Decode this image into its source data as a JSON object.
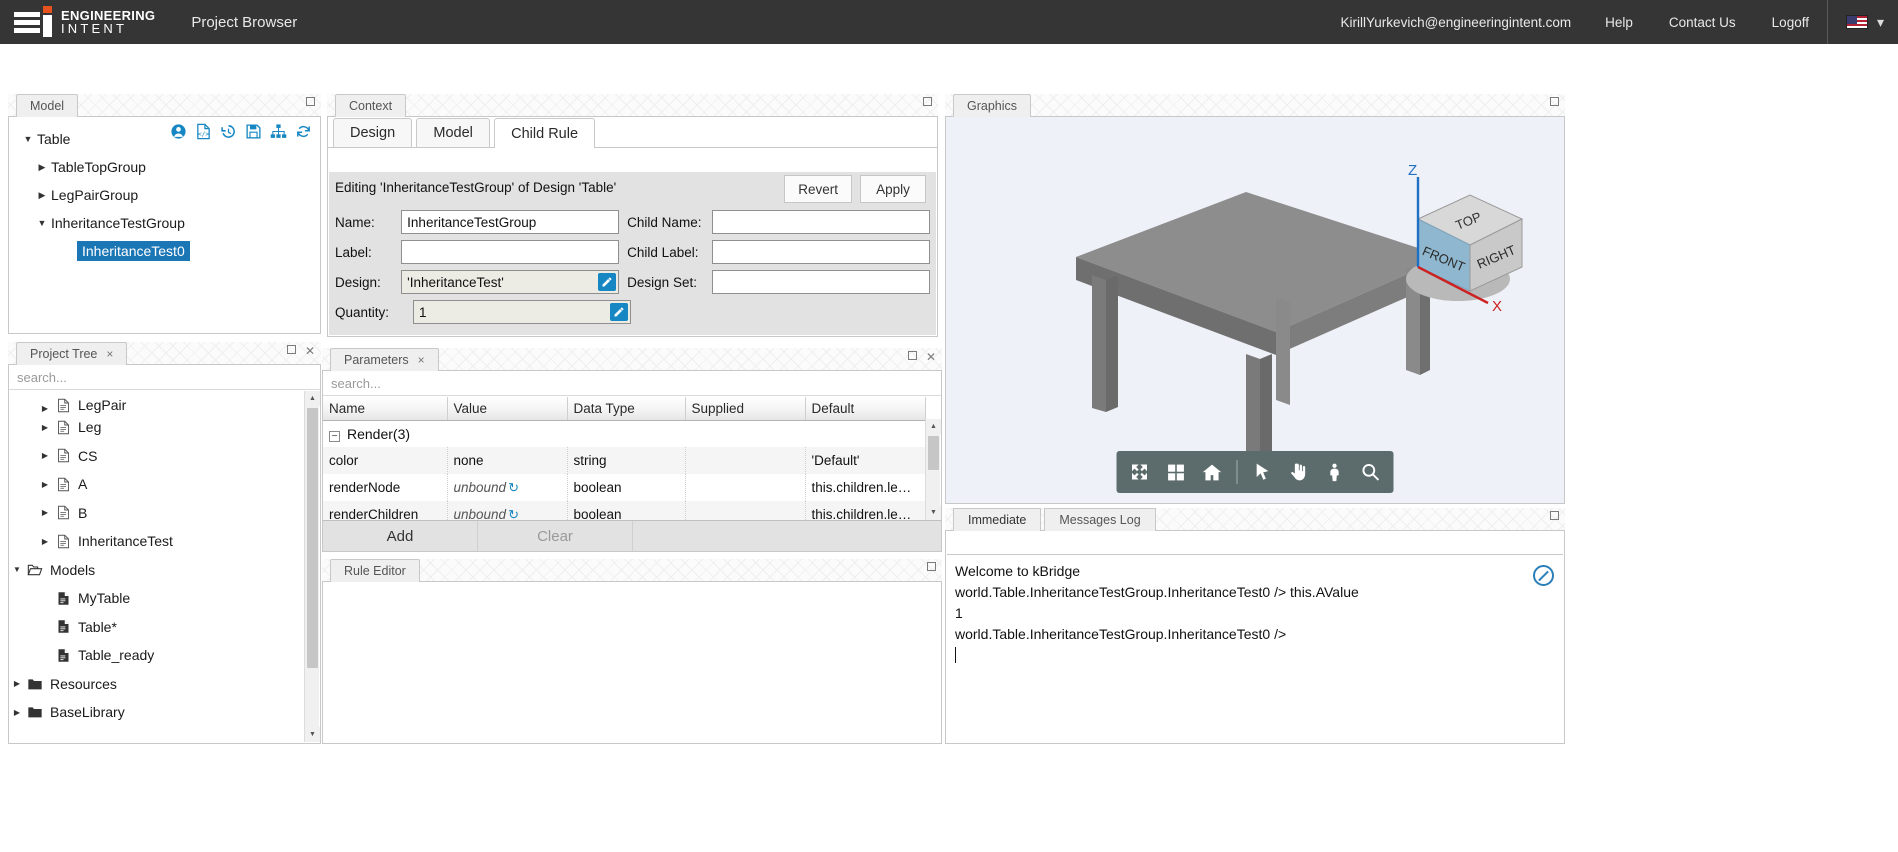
{
  "topbar": {
    "logo_line1": "ENGINEERING",
    "logo_line2": "INTENT",
    "app_title": "Project Browser",
    "email": "KirillYurkevich@engineeringintent.com",
    "help": "Help",
    "contact": "Contact Us",
    "logoff": "Logoff"
  },
  "model_panel": {
    "tab": "Model",
    "toolbar_icons": [
      "user-icon",
      "code-file-icon",
      "history-icon",
      "save-icon",
      "hierarchy-icon",
      "refresh-icon"
    ],
    "tree": [
      {
        "label": "Table",
        "state": "open",
        "depth": 0,
        "selected": false
      },
      {
        "label": "TableTopGroup",
        "state": "closed",
        "depth": 1,
        "selected": false
      },
      {
        "label": "LegPairGroup",
        "state": "closed",
        "depth": 1,
        "selected": false
      },
      {
        "label": "InheritanceTestGroup",
        "state": "open",
        "depth": 1,
        "selected": false
      },
      {
        "label": "InheritanceTest0",
        "state": "leaf",
        "depth": 2,
        "selected": true
      }
    ]
  },
  "project_panel": {
    "tab": "Project Tree",
    "close_label": "×",
    "search_placeholder": "search...",
    "search_value": "",
    "nodes": [
      {
        "label": "LegPair",
        "icon": "design-file-icon",
        "state": "closed",
        "depth": 1,
        "clipped": true
      },
      {
        "label": "Leg",
        "icon": "design-file-icon",
        "state": "closed",
        "depth": 1
      },
      {
        "label": "CS",
        "icon": "design-file-icon",
        "state": "closed",
        "depth": 1
      },
      {
        "label": "A",
        "icon": "design-file-icon",
        "state": "closed",
        "depth": 1
      },
      {
        "label": "B",
        "icon": "design-file-icon",
        "state": "closed",
        "depth": 1
      },
      {
        "label": "InheritanceTest",
        "icon": "design-file-icon",
        "state": "closed",
        "depth": 1
      },
      {
        "label": "Models",
        "icon": "folder-open-icon",
        "state": "open",
        "depth": 0
      },
      {
        "label": "MyTable",
        "icon": "model-file-icon",
        "state": "leaf",
        "depth": 1
      },
      {
        "label": "Table*",
        "icon": "model-file-icon",
        "state": "leaf",
        "depth": 1
      },
      {
        "label": "Table_ready",
        "icon": "model-file-icon",
        "state": "leaf",
        "depth": 1
      },
      {
        "label": "Resources",
        "icon": "folder-icon",
        "state": "closed",
        "depth": 0
      },
      {
        "label": "BaseLibrary",
        "icon": "folder-icon",
        "state": "closed",
        "depth": 0
      }
    ]
  },
  "context_panel": {
    "tab": "Context",
    "tabs": [
      {
        "label": "Design",
        "active": false
      },
      {
        "label": "Model",
        "active": false
      },
      {
        "label": "Child Rule",
        "active": true
      }
    ],
    "editing_text": "Editing 'InheritanceTestGroup' of Design 'Table'",
    "revert_label": "Revert",
    "apply_label": "Apply",
    "fields": {
      "name_label": "Name:",
      "name_value": "InheritanceTestGroup",
      "label_label": "Label:",
      "label_value": "",
      "design_label": "Design:",
      "design_value": "'InheritanceTest'",
      "quantity_label": "Quantity:",
      "quantity_value": "1",
      "child_name_label": "Child Name:",
      "child_name_value": "",
      "child_label_label": "Child Label:",
      "child_label_value": "",
      "design_set_label": "Design Set:",
      "design_set_value": ""
    }
  },
  "parameters_panel": {
    "tab": "Parameters",
    "close_label": "×",
    "search_placeholder": "search...",
    "search_value": "",
    "columns": [
      "Name",
      "Value",
      "Data Type",
      "Supplied",
      "Default"
    ],
    "group": {
      "label": "Render",
      "count": "(3)",
      "expanded": true
    },
    "rows": [
      {
        "name": "color",
        "value": "none",
        "value_italic": false,
        "sync": false,
        "data_type": "string",
        "supplied": "",
        "default": "'Default'"
      },
      {
        "name": "renderNode",
        "value": "unbound",
        "value_italic": true,
        "sync": true,
        "data_type": "boolean",
        "supplied": "",
        "default": "this.children.le…"
      },
      {
        "name": "renderChildren",
        "value": "unbound",
        "value_italic": true,
        "sync": true,
        "data_type": "boolean",
        "supplied": "",
        "default": "this.children.le…"
      }
    ],
    "add_label": "Add",
    "clear_label": "Clear"
  },
  "rule_panel": {
    "tab": "Rule Editor",
    "content": ""
  },
  "graphics_panel": {
    "tab": "Graphics",
    "viewcube": {
      "top": "TOP",
      "front": "FRONT",
      "right": "RIGHT"
    },
    "axes": {
      "z": "Z",
      "x": "X"
    },
    "toolbar_icons": [
      "fit-icon",
      "grid-icon",
      "home-icon",
      "select-icon",
      "pan-icon",
      "orbit-icon",
      "zoom-icon"
    ]
  },
  "console_panel": {
    "tabs": [
      {
        "label": "Immediate",
        "active": true
      },
      {
        "label": "Messages Log",
        "active": false
      }
    ],
    "lines": [
      "Welcome to kBridge",
      "world.Table.InheritanceTestGroup.InheritanceTest0 /> this.AValue",
      "1",
      "world.Table.InheritanceTestGroup.InheritanceTest0 />"
    ]
  },
  "colors": {
    "topbar_bg": "#353535",
    "accent_blue": "#1787c4",
    "selection_blue": "#1b76b5",
    "panel_gray": "#e2e2e2",
    "logo_orange": "#e8521f"
  }
}
